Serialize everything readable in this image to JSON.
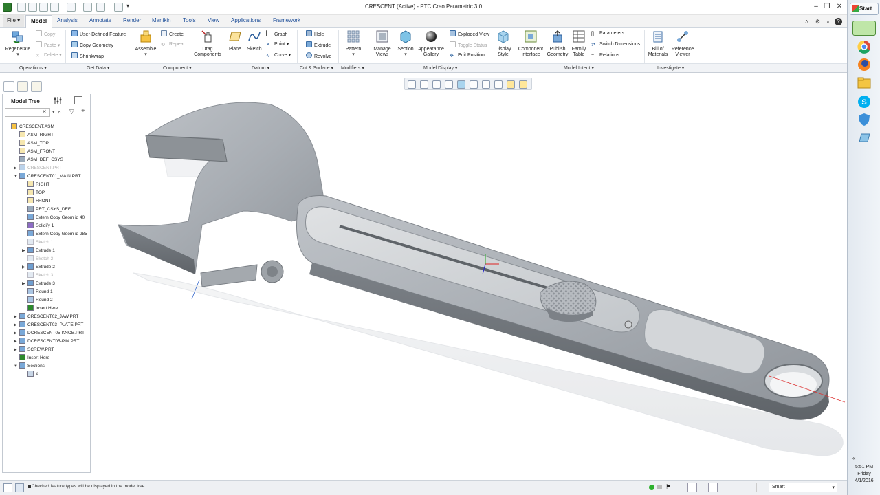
{
  "window": {
    "title": "CRESCENT (Active) - PTC Creo Parametric 3.0"
  },
  "menu": {
    "file": "File",
    "tabs": [
      "Model",
      "Analysis",
      "Annotate",
      "Render",
      "Manikin",
      "Tools",
      "View",
      "Applications",
      "Framework"
    ],
    "active": "Model"
  },
  "ribbon": {
    "operations": {
      "regenerate": "Regenerate",
      "copy": "Copy",
      "paste": "Paste",
      "delete": "Delete",
      "udf": "User-Defined Feature",
      "copy_geometry": "Copy Geometry",
      "shrinkwrap": "Shrinkwrap",
      "create": "Create",
      "repeat": "Repeat",
      "assemble": "Assemble"
    },
    "component": {
      "drag": [
        "Drag",
        "Components"
      ]
    },
    "datum": {
      "plane": "Plane",
      "sketch": "Sketch",
      "graph": "Graph",
      "point": "Point",
      "curve": "Curve"
    },
    "cut": {
      "hole": "Hole",
      "extrude": "Extrude",
      "revolve": "Revolve"
    },
    "modifiers": {
      "pattern": "Pattern"
    },
    "model_display": {
      "manage_views": [
        "Manage",
        "Views"
      ],
      "section": "Section",
      "appearance": [
        "Appearance",
        "Gallery"
      ],
      "exploded_view": "Exploded View",
      "toggle_status": "Toggle Status",
      "edit_position": "Edit Position",
      "display_style": [
        "Display",
        "Style"
      ]
    },
    "model_intent": {
      "component_interface": [
        "Component",
        "Interface"
      ],
      "publish_geometry": [
        "Publish",
        "Geometry"
      ],
      "family_table": [
        "Family",
        "Table"
      ],
      "parameters": "Parameters",
      "switch_dimensions": "Switch Dimensions",
      "relations": "Relations"
    },
    "investigate": {
      "bom": [
        "Bill of",
        "Materials"
      ],
      "reference_viewer": [
        "Reference",
        "Viewer"
      ]
    },
    "groups": [
      "Operations",
      "Get Data",
      "Component",
      "Datum",
      "Cut & Surface",
      "Modifiers",
      "Model Display",
      "Model Intent",
      "Investigate"
    ]
  },
  "tree": {
    "title": "Model Tree",
    "items": [
      {
        "label": "CRESCENT.ASM",
        "icon": "assembly-icon",
        "exp": ""
      },
      {
        "label": "ASM_RIGHT",
        "icon": "datum-plane-icon",
        "exp": ""
      },
      {
        "label": "ASM_TOP",
        "icon": "datum-plane-icon",
        "exp": ""
      },
      {
        "label": "ASM_FRONT",
        "icon": "datum-plane-icon",
        "exp": ""
      },
      {
        "label": "ASM_DEF_CSYS",
        "icon": "csys-icon",
        "exp": ""
      },
      {
        "label": "CRESCENT.PRT",
        "icon": "part-icon",
        "exp": "▶",
        "ghost": true
      },
      {
        "label": "CRESCENT01_MAIN.PRT",
        "icon": "part-icon",
        "exp": "▼"
      },
      {
        "label": "RIGHT",
        "icon": "datum-plane-icon",
        "exp": ""
      },
      {
        "label": "TOP",
        "icon": "datum-plane-icon",
        "exp": ""
      },
      {
        "label": "FRONT",
        "icon": "datum-plane-icon",
        "exp": ""
      },
      {
        "label": "PRT_CSYS_DEF",
        "icon": "csys-icon",
        "exp": ""
      },
      {
        "label": "Extern Copy Geom id 40",
        "icon": "copy-geom-icon",
        "exp": ""
      },
      {
        "label": "Solidify 1",
        "icon": "solidify-icon",
        "exp": ""
      },
      {
        "label": "Extern Copy Geom id 285",
        "icon": "copy-geom-icon",
        "exp": ""
      },
      {
        "label": "Sketch 1",
        "icon": "sketch-icon",
        "exp": "",
        "ghost": true
      },
      {
        "label": "Extrude 1",
        "icon": "extrude-icon",
        "exp": "▶"
      },
      {
        "label": "Sketch 2",
        "icon": "sketch-icon",
        "exp": "",
        "ghost": true
      },
      {
        "label": "Extrude 2",
        "icon": "extrude-icon",
        "exp": "▶"
      },
      {
        "label": "Sketch 3",
        "icon": "sketch-icon",
        "exp": "",
        "ghost": true
      },
      {
        "label": "Extrude 3",
        "icon": "extrude-icon",
        "exp": "▶"
      },
      {
        "label": "Round 1",
        "icon": "round-icon",
        "exp": ""
      },
      {
        "label": "Round 2",
        "icon": "round-icon",
        "exp": ""
      },
      {
        "label": "Insert Here",
        "icon": "insert-arrow-icon",
        "exp": ""
      },
      {
        "label": "CRESCENT02_JAW.PRT",
        "icon": "part-icon",
        "exp": "▶"
      },
      {
        "label": "CRESCENT03_PLATE.PRT",
        "icon": "part-icon",
        "exp": "▶"
      },
      {
        "label": "DCRESCENT05-KNOB.PRT",
        "icon": "part-icon",
        "exp": "▶"
      },
      {
        "label": "DCRESCENT05-PIN.PRT",
        "icon": "part-icon",
        "exp": "▶"
      },
      {
        "label": "SCREW.PRT",
        "icon": "part-icon",
        "exp": "▶"
      },
      {
        "label": "Insert Here",
        "icon": "insert-arrow-icon",
        "exp": ""
      },
      {
        "label": "Sections",
        "icon": "sections-icon",
        "exp": "▼"
      },
      {
        "label": "A",
        "icon": "section-icon",
        "exp": ""
      }
    ]
  },
  "status": {
    "message": "Checked feature types will be displayed in the model tree.",
    "filter": "Smart"
  },
  "taskbar": {
    "start": "Start",
    "time": "5:51 PM",
    "day": "Friday",
    "date": "4/1/2016"
  },
  "colors": {
    "accent": "#1f4f99",
    "model_gray": "#9ea3aa",
    "taskbar": "#e7edf3"
  }
}
